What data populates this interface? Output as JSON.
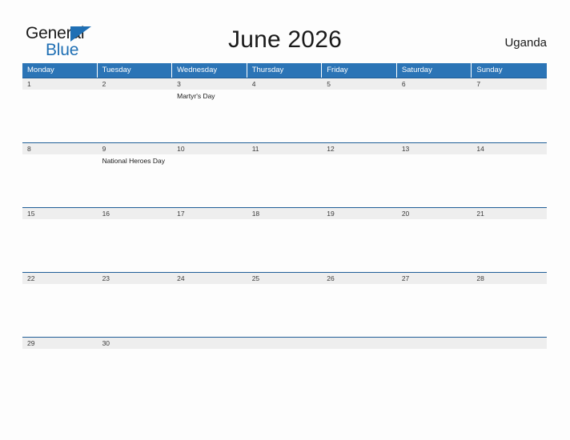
{
  "logo": {
    "word_top": "General",
    "word_bottom": "Blue",
    "triangle_icon": "blue-triangle-icon",
    "brand_color": "#1f6fb4"
  },
  "header": {
    "title": "June 2026",
    "country": "Uganda"
  },
  "colors": {
    "weekday_header_bg": "#2b74b6",
    "week_band_bg": "#eeeeee",
    "week_band_rule": "#1f5d97",
    "page_bg": "#fdfdfd",
    "text": "#1a1a1a"
  },
  "calendar": {
    "weekdays": [
      "Monday",
      "Tuesday",
      "Wednesday",
      "Thursday",
      "Friday",
      "Saturday",
      "Sunday"
    ],
    "weeks": [
      {
        "days": [
          {
            "number": "1",
            "event": ""
          },
          {
            "number": "2",
            "event": ""
          },
          {
            "number": "3",
            "event": "Martyr's Day"
          },
          {
            "number": "4",
            "event": ""
          },
          {
            "number": "5",
            "event": ""
          },
          {
            "number": "6",
            "event": ""
          },
          {
            "number": "7",
            "event": ""
          }
        ]
      },
      {
        "days": [
          {
            "number": "8",
            "event": ""
          },
          {
            "number": "9",
            "event": "National Heroes Day"
          },
          {
            "number": "10",
            "event": ""
          },
          {
            "number": "11",
            "event": ""
          },
          {
            "number": "12",
            "event": ""
          },
          {
            "number": "13",
            "event": ""
          },
          {
            "number": "14",
            "event": ""
          }
        ]
      },
      {
        "days": [
          {
            "number": "15",
            "event": ""
          },
          {
            "number": "16",
            "event": ""
          },
          {
            "number": "17",
            "event": ""
          },
          {
            "number": "18",
            "event": ""
          },
          {
            "number": "19",
            "event": ""
          },
          {
            "number": "20",
            "event": ""
          },
          {
            "number": "21",
            "event": ""
          }
        ]
      },
      {
        "days": [
          {
            "number": "22",
            "event": ""
          },
          {
            "number": "23",
            "event": ""
          },
          {
            "number": "24",
            "event": ""
          },
          {
            "number": "25",
            "event": ""
          },
          {
            "number": "26",
            "event": ""
          },
          {
            "number": "27",
            "event": ""
          },
          {
            "number": "28",
            "event": ""
          }
        ]
      },
      {
        "days": [
          {
            "number": "29",
            "event": ""
          },
          {
            "number": "30",
            "event": ""
          },
          {
            "number": "",
            "event": ""
          },
          {
            "number": "",
            "event": ""
          },
          {
            "number": "",
            "event": ""
          },
          {
            "number": "",
            "event": ""
          },
          {
            "number": "",
            "event": ""
          }
        ]
      }
    ]
  }
}
